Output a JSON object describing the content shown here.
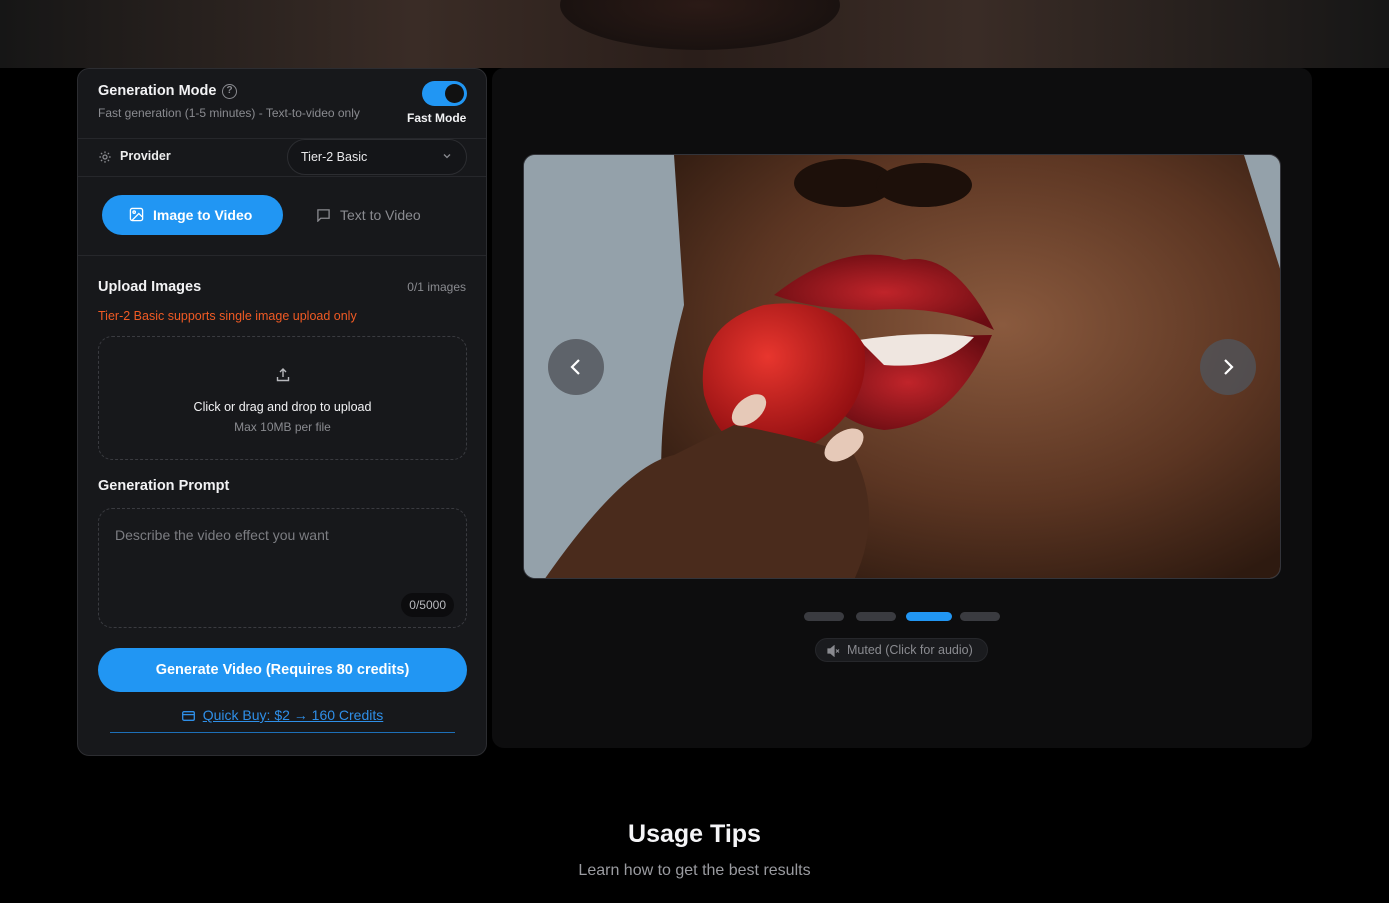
{
  "generation_mode": {
    "title": "Generation Mode",
    "help_icon": "question-circle-icon",
    "subtitle": "Fast generation (1-5 minutes) - Text-to-video only",
    "toggle_on": true,
    "toggle_label": "Fast Mode"
  },
  "provider": {
    "icon": "gear-icon",
    "label": "Provider",
    "selected": "Tier-2 Basic"
  },
  "tabs": [
    {
      "label": "Image to Video",
      "icon": "image-icon",
      "active": true
    },
    {
      "label": "Text to Video",
      "icon": "chat-icon",
      "active": false
    }
  ],
  "upload": {
    "title": "Upload Images",
    "count": "0/1 images",
    "warning": "Tier-2 Basic supports single image upload only",
    "drop_text": "Click or drag and drop to upload",
    "drop_hint": "Max 10MB per file"
  },
  "prompt": {
    "title": "Generation Prompt",
    "placeholder": "Describe the video effect you want",
    "value": "",
    "char_count": "0/5000"
  },
  "generate_button": "Generate Video (Requires 80 credits)",
  "quick_buy": "Quick Buy: $2 → 160 Credits",
  "viewer": {
    "slide_count": 4,
    "active_slide": 3,
    "mute_label": "Muted (Click for audio)"
  },
  "tips": {
    "title": "Usage Tips",
    "subtitle": "Learn how to get the best results"
  },
  "colors": {
    "accent": "#2196f3",
    "warning": "#f05a24",
    "link": "#2f8fe8"
  }
}
